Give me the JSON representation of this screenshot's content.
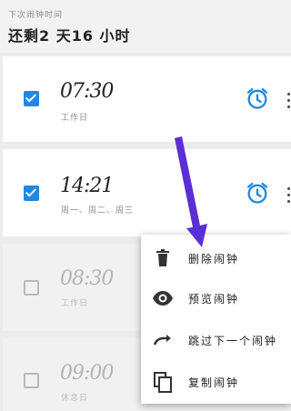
{
  "header": {
    "subtitle": "下次闹钟时间",
    "countdown": "还剩2 天16 小时"
  },
  "alarms": [
    {
      "time": "07:30",
      "days": "工作日",
      "enabled": true
    },
    {
      "time": "14:21",
      "days": "周一、周二、周三",
      "enabled": true
    },
    {
      "time": "08:30",
      "days": "工作日",
      "enabled": false
    },
    {
      "time": "09:00",
      "days": "休息日",
      "enabled": false
    }
  ],
  "menu": {
    "items": [
      {
        "label": "删除闹钟",
        "icon": "trash-icon"
      },
      {
        "label": "预览闹钟",
        "icon": "eye-icon"
      },
      {
        "label": "跳过下一个闹钟",
        "icon": "redo-arrow-icon"
      },
      {
        "label": "复制闹钟",
        "icon": "copy-icon"
      }
    ]
  },
  "colors": {
    "accent": "#1e88e5",
    "annotation_arrow": "#5b2fd6"
  }
}
